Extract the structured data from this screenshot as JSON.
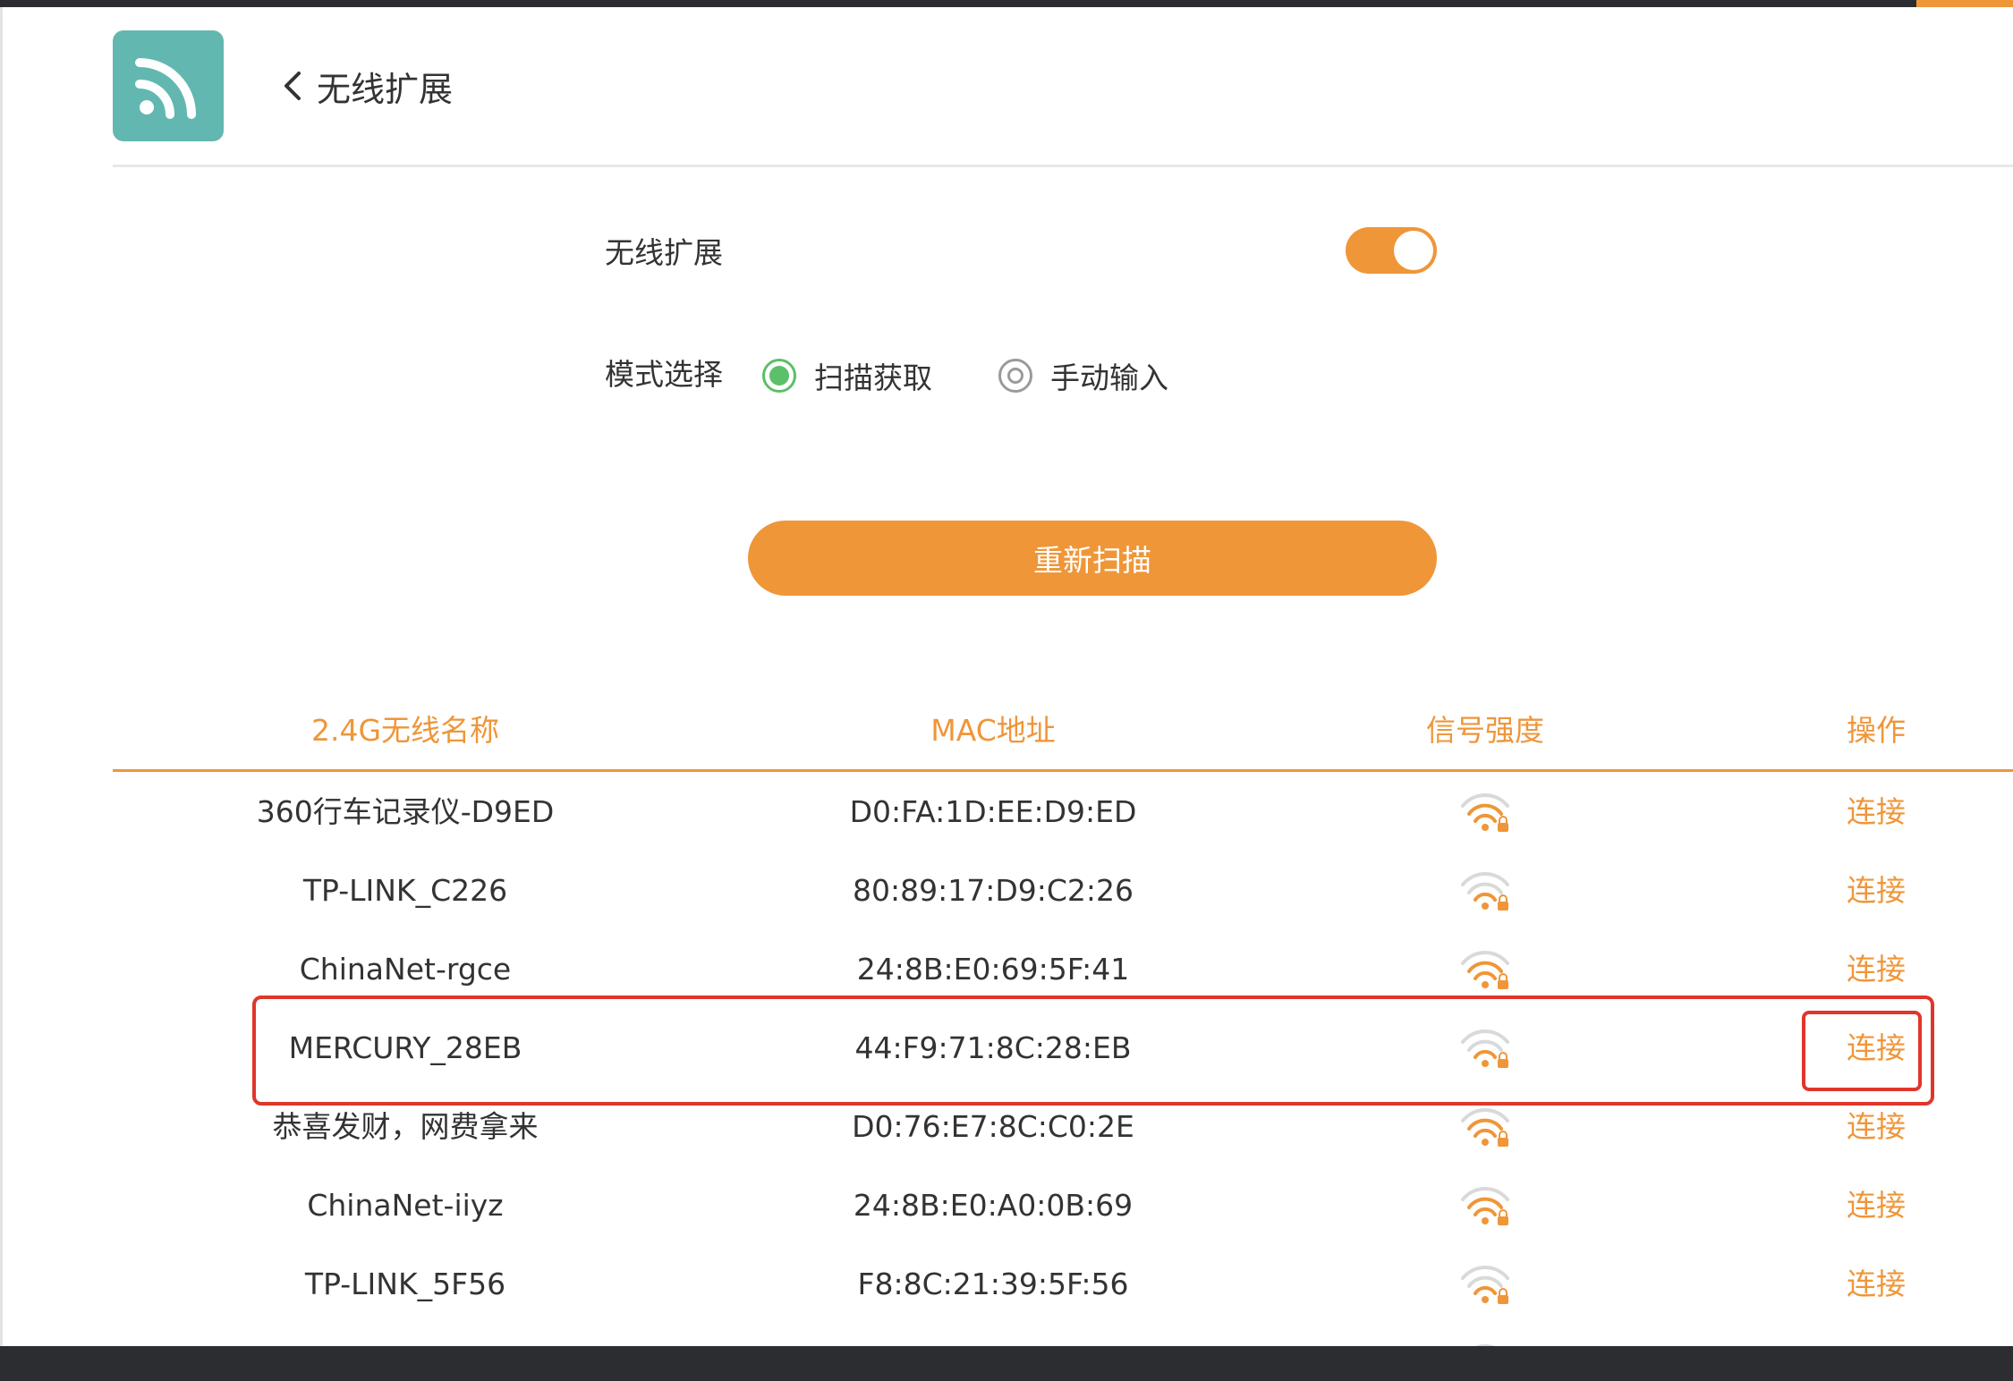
{
  "header": {
    "app_icon": "wireless-extend-icon",
    "back_icon": "chevron-left-icon",
    "title": "无线扩展"
  },
  "settings": {
    "toggle_label": "无线扩展",
    "toggle_on": true,
    "mode_label": "模式选择",
    "modes": [
      {
        "label": "扫描获取",
        "selected": true
      },
      {
        "label": "手动输入",
        "selected": false
      }
    ],
    "rescan_label": "重新扫描"
  },
  "table": {
    "columns": [
      "2.4G无线名称",
      "MAC地址",
      "信号强度",
      "操作"
    ],
    "rows": [
      {
        "name": "360行车记录仪-D9ED",
        "mac": "D0:FA:1D:EE:D9:ED",
        "signal_icon": "wifi-locked-icon",
        "action": "连接"
      },
      {
        "name": "TP-LINK_C226",
        "mac": "80:89:17:D9:C2:26",
        "signal_icon": "wifi-locked-icon",
        "action": "连接"
      },
      {
        "name": "ChinaNet-rgce",
        "mac": "24:8B:E0:69:5F:41",
        "signal_icon": "wifi-locked-icon",
        "action": "连接"
      },
      {
        "name": "MERCURY_28EB",
        "mac": "44:F9:71:8C:28:EB",
        "signal_icon": "wifi-locked-icon",
        "action": "连接"
      },
      {
        "name": "恭喜发财，网费拿来",
        "mac": "D0:76:E7:8C:C0:2E",
        "signal_icon": "wifi-locked-icon",
        "action": "连接"
      },
      {
        "name": "ChinaNet-iiyz",
        "mac": "24:8B:E0:A0:0B:69",
        "signal_icon": "wifi-locked-icon",
        "action": "连接"
      },
      {
        "name": "TP-LINK_5F56",
        "mac": "F8:8C:21:39:5F:56",
        "signal_icon": "wifi-locked-icon",
        "action": "连接"
      },
      {
        "name": "",
        "mac": "",
        "signal_icon": "wifi-locked-icon",
        "action": ""
      }
    ]
  },
  "colors": {
    "accent": "#ef9639",
    "teal": "#62b8b0",
    "radio_on": "#5cbf6a",
    "highlight": "#e0362b"
  }
}
